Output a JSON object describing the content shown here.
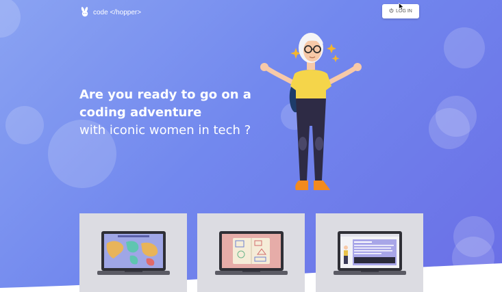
{
  "brand": {
    "name": "code </hopper>",
    "icon": "bunny-icon"
  },
  "header": {
    "login_label": "LOG IN",
    "login_icon": "power-icon"
  },
  "hero": {
    "line1": "Are you ready to go on a",
    "line2": "coding adventure",
    "line3": "with iconic women in tech ?"
  },
  "cards": [
    {
      "icon": "world-map-icon"
    },
    {
      "icon": "passport-icon"
    },
    {
      "icon": "code-editor-icon"
    }
  ],
  "colors": {
    "bg_start": "#8aa3f2",
    "bg_end": "#6a6ee6",
    "card_bg": "#dcdce2",
    "shirt": "#f5d54a",
    "pants": "#2e2b45",
    "shoes": "#f28a1e"
  }
}
